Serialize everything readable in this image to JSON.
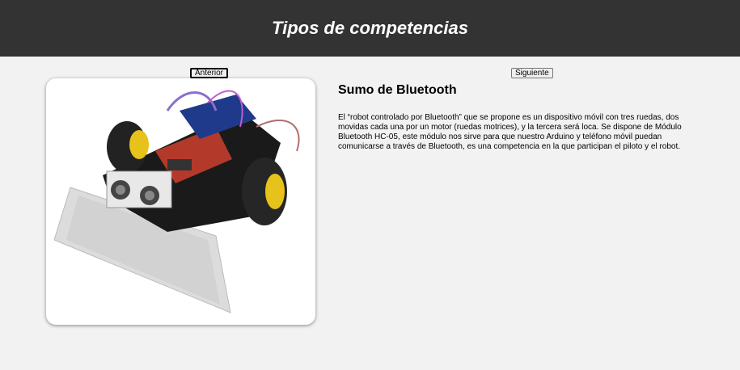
{
  "header": {
    "title": "Tipos de competencias"
  },
  "nav": {
    "prev_label": "Anterior",
    "next_label": "Siguiente"
  },
  "competition": {
    "name": "Sumo de Bluetooth",
    "description": "El “robot controlado por Bluetooth” que se propone es un dispositivo móvil con tres ruedas, dos movidas cada una por un motor (ruedas motrices), y la tercera será loca. Se dispone de Módulo Bluetooth HC-05, este módulo nos sirve para que nuestro Arduino y teléfono móvil puedan comunicarse a través de Bluetooth, es una competencia en la que participan el piloto y el robot."
  },
  "colors": {
    "header_bg": "#333333",
    "page_bg": "#f2f2f2"
  }
}
